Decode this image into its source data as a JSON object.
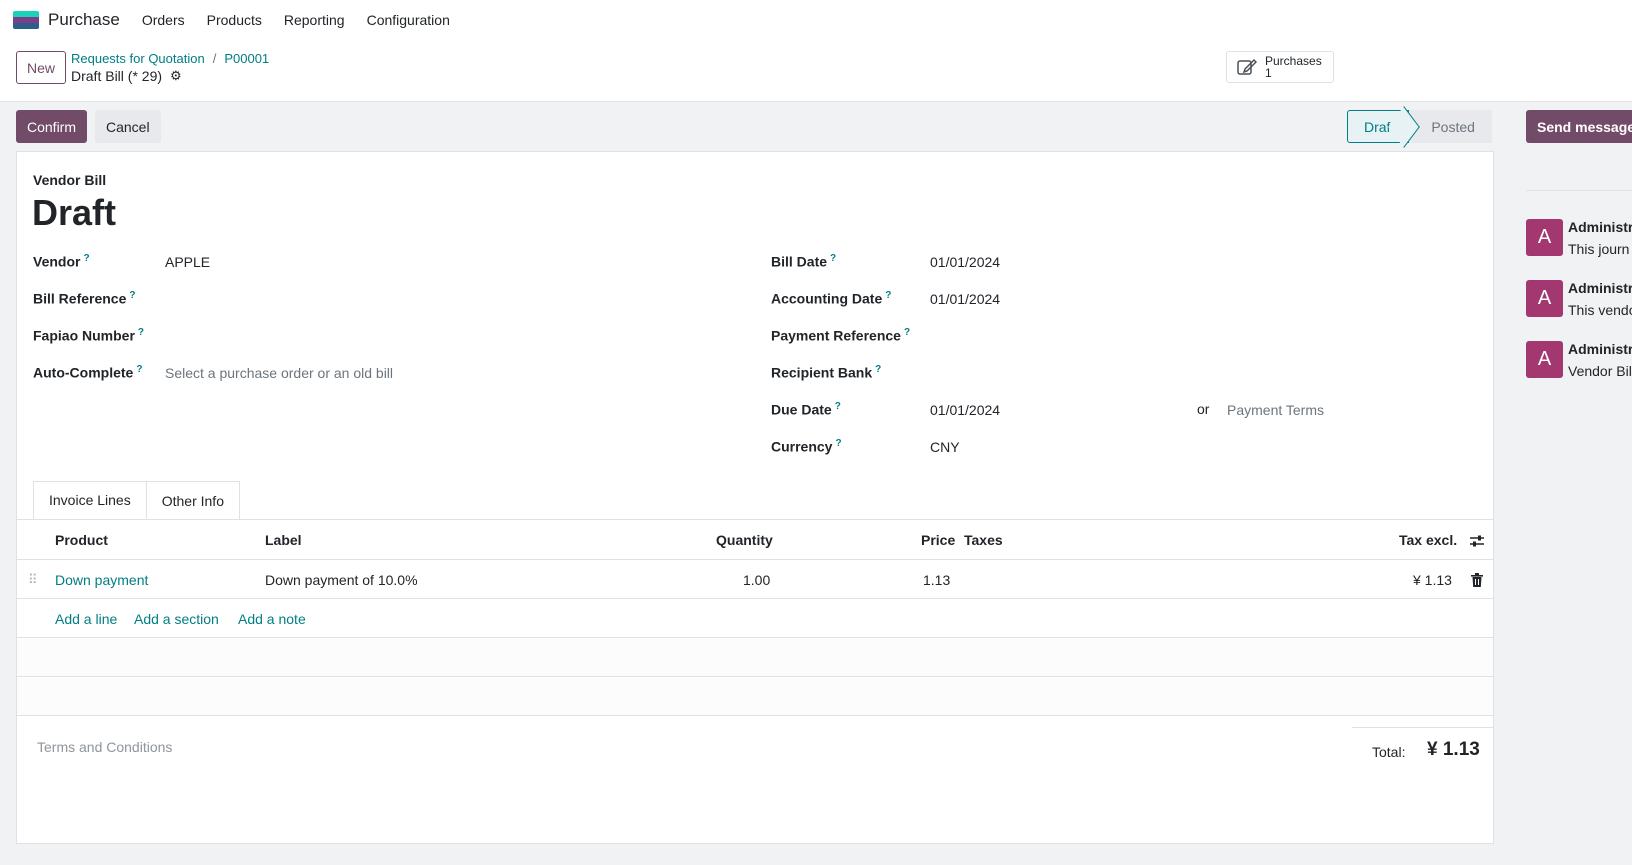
{
  "app": {
    "name": "Purchase",
    "logo_colors": [
      "#1ad3bb",
      "#7c3e87",
      "#2c5e8a"
    ]
  },
  "nav": [
    "Orders",
    "Products",
    "Reporting",
    "Configuration"
  ],
  "control": {
    "new_label": "New",
    "breadcrumb": [
      "Requests for Quotation",
      "P00001"
    ],
    "separator": "/",
    "record_title": "Draft Bill (* 29)",
    "smart_button": {
      "label": "Purchases",
      "count": "1",
      "icon": "edit-icon"
    }
  },
  "actions": {
    "confirm": "Confirm",
    "cancel": "Cancel",
    "status": [
      "Draft",
      "Posted"
    ],
    "send_message": "Send message"
  },
  "form": {
    "doc_type": "Vendor Bill",
    "state": "Draft",
    "help_marker": "?",
    "left": [
      {
        "label": "Vendor",
        "value": "APPLE"
      },
      {
        "label": "Bill Reference",
        "value": ""
      },
      {
        "label": "Fapiao Number",
        "value": ""
      },
      {
        "label": "Auto-Complete",
        "placeholder": "Select a purchase order or an old bill"
      }
    ],
    "right": [
      {
        "label": "Bill Date",
        "value": "01/01/2024"
      },
      {
        "label": "Accounting Date",
        "value": "01/01/2024"
      },
      {
        "label": "Payment Reference",
        "value": ""
      },
      {
        "label": "Recipient Bank",
        "value": ""
      },
      {
        "label": "Due Date",
        "value": "01/01/2024"
      },
      {
        "label": "Currency",
        "value": "CNY"
      }
    ],
    "or_label": "or",
    "payment_terms_placeholder": "Payment Terms"
  },
  "tabs": [
    "Invoice Lines",
    "Other Info"
  ],
  "table": {
    "headers": {
      "product": "Product",
      "label": "Label",
      "quantity": "Quantity",
      "price": "Price",
      "taxes": "Taxes",
      "tax_excl": "Tax excl."
    },
    "rows": [
      {
        "product": "Down payment",
        "label": "Down payment of 10.0%",
        "quantity": "1.00",
        "price": "1.13",
        "taxes": "",
        "tax_excl": "¥ 1.13"
      }
    ],
    "add_links": [
      "Add a line",
      "Add a section",
      "Add a note"
    ]
  },
  "terms_placeholder": "Terms and Conditions",
  "total": {
    "label": "Total:",
    "value": "¥ 1.13"
  },
  "chatter": [
    {
      "avatar": "A",
      "author": "Administr",
      "body": "This journ"
    },
    {
      "avatar": "A",
      "author": "Administr",
      "body": "This vendo"
    },
    {
      "avatar": "A",
      "author": "Administr",
      "body": "Vendor Bil"
    }
  ]
}
